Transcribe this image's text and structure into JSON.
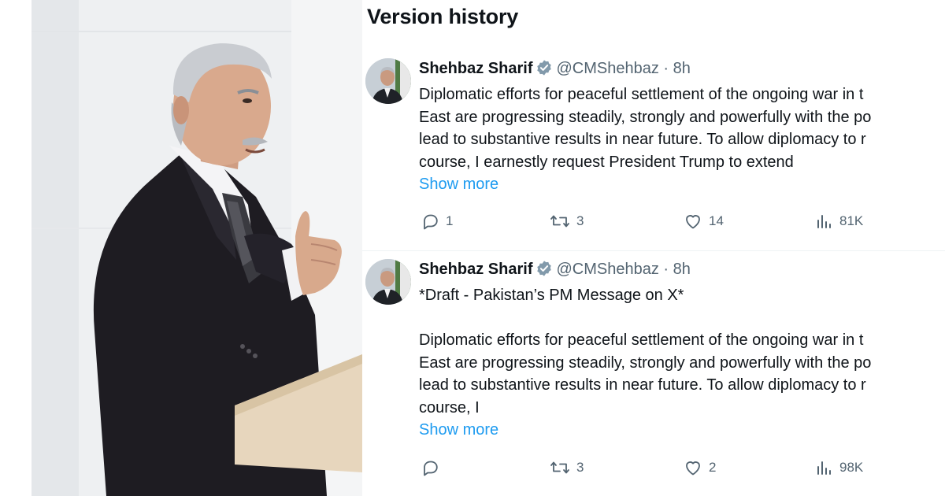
{
  "photo": {
    "alt_icon": "speaker-photo"
  },
  "panel": {
    "title": "Version history"
  },
  "tweets": [
    {
      "author": {
        "name": "Shehbaz Sharif",
        "handle": "@CMShehbaz",
        "separator": "·",
        "time": "8h"
      },
      "lines": [
        "Diplomatic efforts for peaceful settlement of the ongoing war in t",
        "East are progressing steadily, strongly and powerfully with the po",
        "lead to substantive results in near future. To allow diplomacy to r",
        "course, I earnestly request President Trump to extend"
      ],
      "show_more": "Show more",
      "stats": {
        "replies": "1",
        "reposts": "3",
        "likes": "14",
        "views": "81K"
      }
    },
    {
      "author": {
        "name": "Shehbaz Sharif",
        "handle": "@CMShehbaz",
        "separator": "·",
        "time": "8h"
      },
      "heading": "*Draft - Pakistan’s PM Message on X*",
      "lines": [
        "Diplomatic efforts for peaceful settlement of the ongoing war in t",
        "East are progressing steadily, strongly and powerfully with the po",
        "lead to substantive results in near future. To allow diplomacy to r",
        "course, I"
      ],
      "show_more": "Show more",
      "stats": {
        "replies": "",
        "reposts": "3",
        "likes": "2",
        "views": "98K"
      }
    }
  ],
  "colors": {
    "accent": "#1d9bf0",
    "muted": "#536471",
    "text": "#0f1419",
    "verified": "#829aab"
  }
}
